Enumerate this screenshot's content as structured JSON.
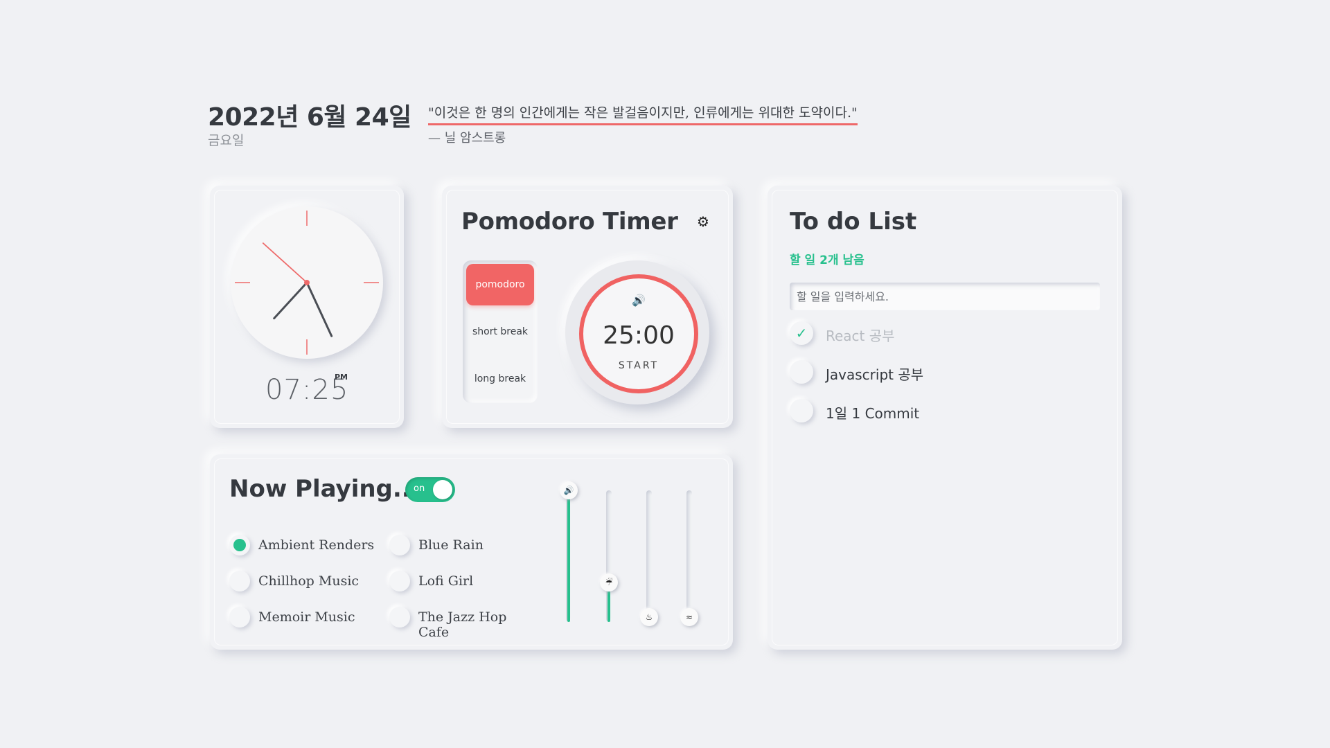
{
  "header": {
    "date": "2022년 6월 24일",
    "weekday": "금요일",
    "quote": "\"이것은 한 명의 인간에게는 작은 발걸음이지만, 인류에게는 위대한 도약이다.\"",
    "author": "— 닐 암스트롱"
  },
  "clock": {
    "time": "07:25",
    "ampm": "PM",
    "hour": 7,
    "minute": 25,
    "second": 52
  },
  "pomodoro": {
    "title": "Pomodoro Timer",
    "settings_icon": "gear-icon",
    "modes": [
      "pomodoro",
      "short break",
      "long break"
    ],
    "active_mode": "pomodoro",
    "time": "25:00",
    "start_label": "START",
    "sound_icon": "speaker-icon",
    "accent": "#f16565"
  },
  "now_playing": {
    "title": "Now Playing...",
    "toggle_label": "on",
    "toggle_on": true,
    "accent": "#27c08d",
    "stations": [
      {
        "label": "Ambient Renders",
        "selected": true
      },
      {
        "label": "Blue Rain",
        "selected": false
      },
      {
        "label": "Chillhop Music",
        "selected": false
      },
      {
        "label": "Lofi Girl",
        "selected": false
      },
      {
        "label": "Memoir Music",
        "selected": false
      },
      {
        "label": "The Jazz Hop Cafe",
        "selected": false
      }
    ],
    "sliders": [
      {
        "icon": "speaker-icon",
        "glyph": "🔊",
        "level": 1.0
      },
      {
        "icon": "rain-cloud-icon",
        "glyph": "☔",
        "level": 0.3
      },
      {
        "icon": "campfire-icon",
        "glyph": "♨",
        "level": 0.0
      },
      {
        "icon": "wave-icon",
        "glyph": "≈",
        "level": 0.0
      }
    ]
  },
  "todo": {
    "title": "To do List",
    "remaining": "할 일 2개 남음",
    "input_placeholder": "할 일을 입력하세요.",
    "items": [
      {
        "text": "React 공부",
        "done": true
      },
      {
        "text": "Javascript 공부",
        "done": false
      },
      {
        "text": "1일 1 Commit",
        "done": false
      }
    ]
  }
}
